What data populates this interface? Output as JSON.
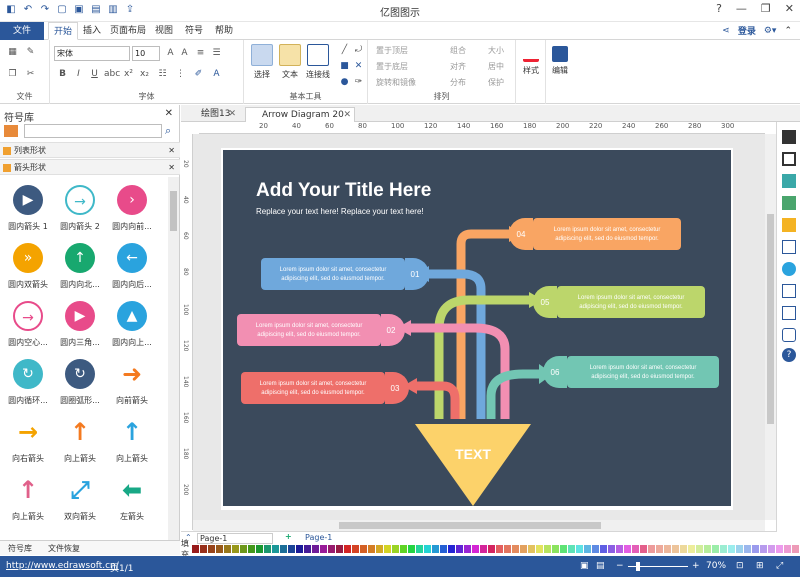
{
  "window": {
    "title": "亿图图示",
    "controls": [
      "?",
      "—",
      "❐",
      "✕"
    ]
  },
  "ribbon_tabs": {
    "file": "文件",
    "items": [
      "开始",
      "插入",
      "页面布局",
      "视图",
      "符号",
      "帮助"
    ],
    "active": "开始"
  },
  "account": {
    "login": "登录"
  },
  "font": {
    "name": "宋体",
    "size": "10"
  },
  "ribbon_groups": {
    "file": "文件",
    "font": "字体",
    "basic_tools": "基本工具",
    "arrange": "排列"
  },
  "tools": {
    "select": "选择",
    "text": "文本",
    "connector": "连接线",
    "style": "样式",
    "edit": "编辑"
  },
  "arrange": {
    "bring_front": "置于顶层",
    "send_back": "置于底层",
    "rotate": "旋转和镜像",
    "group": "组合",
    "align": "对齐",
    "distribute": "分布",
    "size": "大小",
    "center": "居中",
    "protect": "保护"
  },
  "symbol_panel": {
    "title": "符号库",
    "categories": [
      "列表形状",
      "箭头形状"
    ]
  },
  "shapes": [
    {
      "label": "圆内箭头 1",
      "icon": "circle-arrow-icon",
      "color": "#3d5a80"
    },
    {
      "label": "圆内箭头 2",
      "icon": "circle-arrow-outline-icon",
      "color": "#3fb8c8"
    },
    {
      "label": "圆内向前...",
      "icon": "circle-chevron-icon",
      "color": "#e84b8a"
    },
    {
      "label": "圆内双箭头",
      "icon": "circle-double-chevron-icon",
      "color": "#f4a300"
    },
    {
      "label": "圆内向北...",
      "icon": "circle-up-arrow-icon",
      "color": "#18a86f"
    },
    {
      "label": "圆内向后...",
      "icon": "circle-left-arrow-icon",
      "color": "#2aa3de"
    },
    {
      "label": "圆内空心...",
      "icon": "circle-hollow-arrow-icon",
      "color": "#e84b8a"
    },
    {
      "label": "圆内三角...",
      "icon": "circle-triangle-icon",
      "color": "#e84b8a"
    },
    {
      "label": "圆内向上...",
      "icon": "circle-up-triangle-icon",
      "color": "#2aa3de"
    },
    {
      "label": "圆内循环...",
      "icon": "circle-cycle-icon",
      "color": "#3fb8c8"
    },
    {
      "label": "圆圈弧形...",
      "icon": "circle-refresh-icon",
      "color": "#3d5a80"
    },
    {
      "label": "向前箭头",
      "icon": "forward-arrow-icon",
      "color": "#f47a20"
    },
    {
      "label": "向右箭头",
      "icon": "right-arrow-icon",
      "color": "#f4a300"
    },
    {
      "label": "向上箭头",
      "icon": "up-arrow-icon",
      "color": "#f47a20"
    },
    {
      "label": "向上箭头",
      "icon": "up-arrow-thin-icon",
      "color": "#2aa3de"
    },
    {
      "label": "向上箭头",
      "icon": "up-arrow-pink-icon",
      "color": "#e0608a"
    },
    {
      "label": "双向箭头",
      "icon": "double-arrow-icon",
      "color": "#2aa3de"
    },
    {
      "label": "左箭头",
      "icon": "left-arrow-icon",
      "color": "#18a886"
    }
  ],
  "left_bottom_tabs": [
    "符号库",
    "文件恢复"
  ],
  "doc_tabs": [
    {
      "label": "绘图13",
      "active": false
    },
    {
      "label": "Arrow Diagram 20",
      "active": true
    }
  ],
  "diagram": {
    "title": "Add Your Title Here",
    "subtitle": "Replace your text here!   Replace your text here!",
    "center_label": "TEXT",
    "bg": "#3b4a5c",
    "boxes": [
      {
        "num": "01",
        "line1": "Lorem ipsum dolor sit amet, consectetur",
        "line2": "adipiscing elit, sed do eiusmod tempor.",
        "color": "#6fa8dc"
      },
      {
        "num": "02",
        "line1": "Lorem ipsum dolor sit amet, consectetur",
        "line2": "adipiscing elit, sed do eiusmod tempor.",
        "color": "#f28fb2"
      },
      {
        "num": "03",
        "line1": "Lorem ipsum dolor sit amet, consectetur",
        "line2": "adipiscing elit, sed do eiusmod tempor.",
        "color": "#ee6f6a"
      },
      {
        "num": "04",
        "line1": "Lorem ipsum dolor sit amet, consectetur",
        "line2": "adipiscing elit, sed do eiusmod tempor.",
        "color": "#f9a563"
      },
      {
        "num": "05",
        "line1": "Lorem ipsum dolor sit amet, consectetur",
        "line2": "adipiscing elit, sed do eiusmod tempor.",
        "color": "#bcd66b"
      },
      {
        "num": "06",
        "line1": "Lorem ipsum dolor sit amet, consectetur",
        "line2": "adipiscing elit, sed do eiusmod tempor.",
        "color": "#72c6b3"
      }
    ],
    "funnel_color": "#fcd26a"
  },
  "ruler_marks": [
    "20",
    "40",
    "60",
    "80",
    "100",
    "120",
    "140",
    "160",
    "180",
    "200",
    "220",
    "240",
    "260",
    "280",
    "300"
  ],
  "vruler_marks": [
    "20",
    "40",
    "60",
    "80",
    "100",
    "120",
    "140",
    "160",
    "180",
    "200"
  ],
  "page_bar": {
    "page_select": "Page-1",
    "add": "+",
    "current": "Page-1",
    "fill_label": "填充"
  },
  "status": {
    "url": "http://www.edrawsoft.cn/",
    "page": "页1/1",
    "zoom": "70%"
  }
}
